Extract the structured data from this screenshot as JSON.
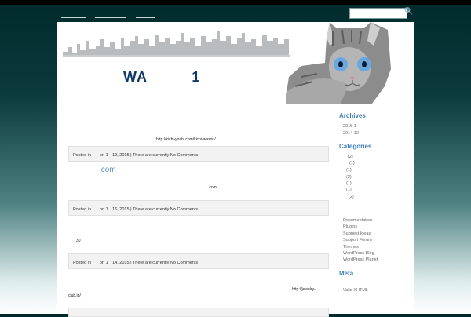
{
  "site": {
    "title": "WA　　　1",
    "tagline": ""
  },
  "nav": {
    "items": [
      "",
      "",
      ""
    ]
  },
  "search": {
    "placeholder": "",
    "button_icon": "magnifier-icon"
  },
  "posts": [
    {
      "title": "",
      "excerpt": "http://kichi-yoshi.com/kichi-wasou/",
      "meta": "Posted in　　on 1　19, 2015 | There are currently No Comments"
    },
    {
      "title": ".com",
      "excerpt": ".com",
      "meta": "Posted in　　on 1　16, 2015 | There are currently No Comments"
    },
    {
      "title": "",
      "excerpt": "30",
      "meta": "Posted in　　on 1　14, 2015 | There are currently No Comments"
    },
    {
      "title": "",
      "excerpt_a": "http://jewelry-",
      "excerpt_b": "club.jp/"
    }
  ],
  "sidebar": {
    "archives": {
      "heading": "Archives",
      "items": [
        "2015 1",
        "2014 12"
      ]
    },
    "categories": {
      "heading": "Categories",
      "items": [
        "(2)",
        "(1)",
        "(1)",
        "(2)",
        "(1)",
        "(1)",
        "(2)"
      ]
    },
    "blogroll": {
      "items": [
        "Documentation",
        "Plugins",
        "Suggest Ideas",
        "Support Forum",
        "Themes",
        "WordPress Blog",
        "WordPress Planet"
      ]
    },
    "meta": {
      "heading": "Meta",
      "items": [
        "Valid XHTML"
      ]
    }
  },
  "colors": {
    "title": "#0f3866",
    "link": "#3d7fb6",
    "background_top": "#002a2c"
  }
}
